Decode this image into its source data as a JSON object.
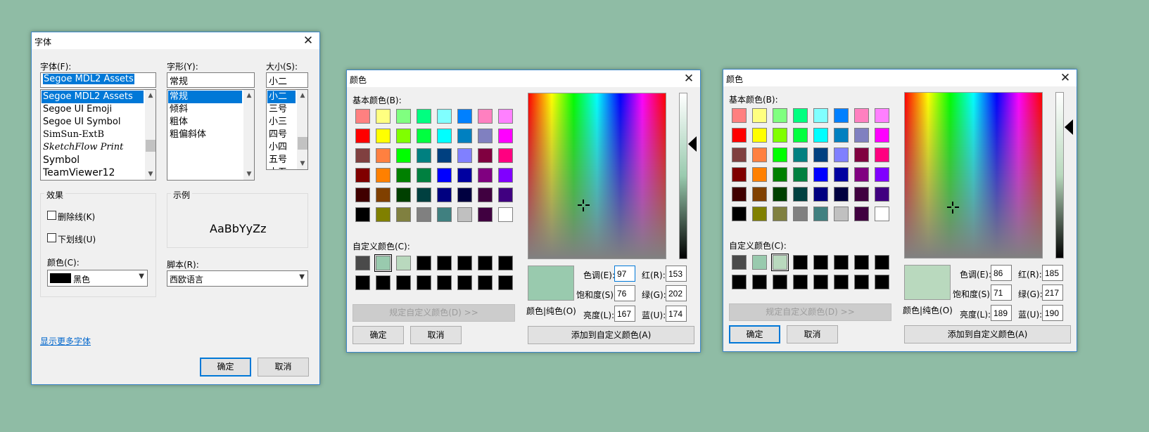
{
  "font_dialog": {
    "title": "字体",
    "font_label": "字体(F):",
    "font_value": "Segoe MDL2 Assets",
    "fonts": [
      "Segoe MDL2 Assets",
      "Segoe UI Emoji",
      "Segoe UI Symbol",
      "SimSun-ExtB",
      "SketchFlow Print",
      "Symbol",
      "TeamViewer12"
    ],
    "style_label": "字形(Y):",
    "style_value": "常规",
    "styles": [
      "常规",
      "倾斜",
      "粗体",
      "粗偏斜体"
    ],
    "size_label": "大小(S):",
    "size_value": "小二",
    "sizes": [
      "小二",
      "三号",
      "小三",
      "四号",
      "小四",
      "五号",
      "小五"
    ],
    "effects_label": "效果",
    "strikeout_label": "删除线(K)",
    "underline_label": "下划线(U)",
    "color_label": "颜色(C):",
    "color_value": "黑色",
    "color_swatch": "#000000",
    "sample_label": "示例",
    "sample_text": "AaBbYyZz",
    "script_label": "脚本(R):",
    "script_value": "西欧语言",
    "more_fonts": "显示更多字体",
    "ok": "确定",
    "cancel": "取消"
  },
  "color_dialogs": [
    {
      "title": "颜色",
      "basic_label": "基本颜色(B):",
      "custom_label": "自定义颜色(C):",
      "define_button": "规定自定义颜色(D) >>",
      "ok": "确定",
      "cancel": "取消",
      "add_button": "添加到自定义颜色(A)",
      "solid_label": "颜色|纯色(O)",
      "hue_label": "色调(E):",
      "sat_label": "饱和度(S):",
      "lum_label": "亮度(L):",
      "red_label": "红(R):",
      "green_label": "绿(G):",
      "blue_label": "蓝(U):",
      "hue": "97",
      "sat": "76",
      "lum": "167",
      "red": "153",
      "green": "202",
      "blue": "174",
      "preview_color": "#99caae",
      "custom_colors": [
        "#4a4a4a",
        "#99caae",
        "#b9d9be",
        "#000000",
        "#000000",
        "#000000",
        "#000000",
        "#000000",
        "#000000",
        "#000000",
        "#000000",
        "#000000",
        "#000000",
        "#000000",
        "#000000",
        "#000000"
      ],
      "selected_custom": 1
    },
    {
      "title": "颜色",
      "basic_label": "基本颜色(B):",
      "custom_label": "自定义颜色(C):",
      "define_button": "规定自定义颜色(D) >>",
      "ok": "确定",
      "cancel": "取消",
      "add_button": "添加到自定义颜色(A)",
      "solid_label": "颜色|纯色(O)",
      "hue_label": "色调(E):",
      "sat_label": "饱和度(S):",
      "lum_label": "亮度(L):",
      "red_label": "红(R):",
      "green_label": "绿(G):",
      "blue_label": "蓝(U):",
      "hue": "86",
      "sat": "71",
      "lum": "189",
      "red": "185",
      "green": "217",
      "blue": "190",
      "preview_color": "#b9d9be",
      "custom_colors": [
        "#4a4a4a",
        "#99caae",
        "#b9d9be",
        "#000000",
        "#000000",
        "#000000",
        "#000000",
        "#000000",
        "#000000",
        "#000000",
        "#000000",
        "#000000",
        "#000000",
        "#000000",
        "#000000",
        "#000000"
      ],
      "selected_custom": 2
    }
  ],
  "basic_colors": [
    "#ff8080",
    "#ffff80",
    "#80ff80",
    "#00ff80",
    "#80ffff",
    "#0080ff",
    "#ff80c0",
    "#ff80ff",
    "#ff0000",
    "#ffff00",
    "#80ff00",
    "#00ff40",
    "#00ffff",
    "#0080c0",
    "#8080c0",
    "#ff00ff",
    "#804040",
    "#ff8040",
    "#00ff00",
    "#008080",
    "#004080",
    "#8080ff",
    "#800040",
    "#ff0080",
    "#800000",
    "#ff8000",
    "#008000",
    "#008040",
    "#0000ff",
    "#0000a0",
    "#800080",
    "#8000ff",
    "#400000",
    "#804000",
    "#004000",
    "#004040",
    "#000080",
    "#000040",
    "#400040",
    "#400080",
    "#000000",
    "#808000",
    "#808040",
    "#808080",
    "#408080",
    "#c0c0c0",
    "#400040",
    "#ffffff"
  ]
}
